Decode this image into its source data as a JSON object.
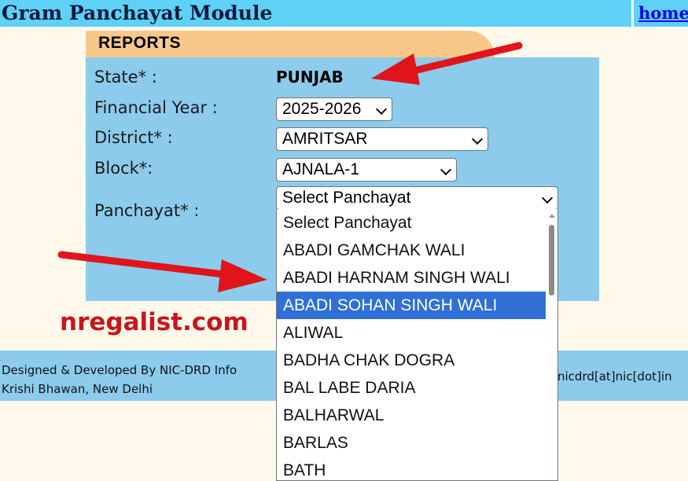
{
  "header": {
    "title": "Gram Panchayat Module",
    "home_link": "home"
  },
  "reports": {
    "tab_label": "REPORTS",
    "state_label": "State* :",
    "state_value": "PUNJAB",
    "financial_year_label": "Financial Year :",
    "financial_year_value": "2025-2026",
    "district_label": "District* :",
    "district_value": "AMRITSAR",
    "block_label": "Block*:",
    "block_value": "AJNALA-1",
    "panchayat_label": "Panchayat* :",
    "panchayat_value": "Select Panchayat"
  },
  "panchayat_options": [
    "Select Panchayat",
    "ABADI GAMCHAK WALI",
    "ABADI HARNAM SINGH WALI",
    "ABADI SOHAN SINGH WALI",
    "ALIWAL",
    "BADHA CHAK DOGRA",
    "BAL LABE DARIA",
    "BALHARWAL",
    "BARLAS",
    "BATH"
  ],
  "selected_option": "ABADI SOHAN SINGH WALI",
  "watermark": "nregalist.com",
  "footer": {
    "line1": "Designed & Developed By NIC-DRD Info",
    "line2": "Krishi Bhawan, New Delhi",
    "contact": "nicdrd[at]nic[dot]in"
  },
  "colors": {
    "header_bg": "#5fd0f6",
    "panel_bg": "#8ccbec",
    "tab_bg": "#f6c98a",
    "page_bg": "#fff9ec",
    "selected_bg": "#2f6fd6",
    "annotation_red": "#e0141b"
  },
  "icons": [
    "chevron-down-icon",
    "red-arrow-annotation"
  ]
}
